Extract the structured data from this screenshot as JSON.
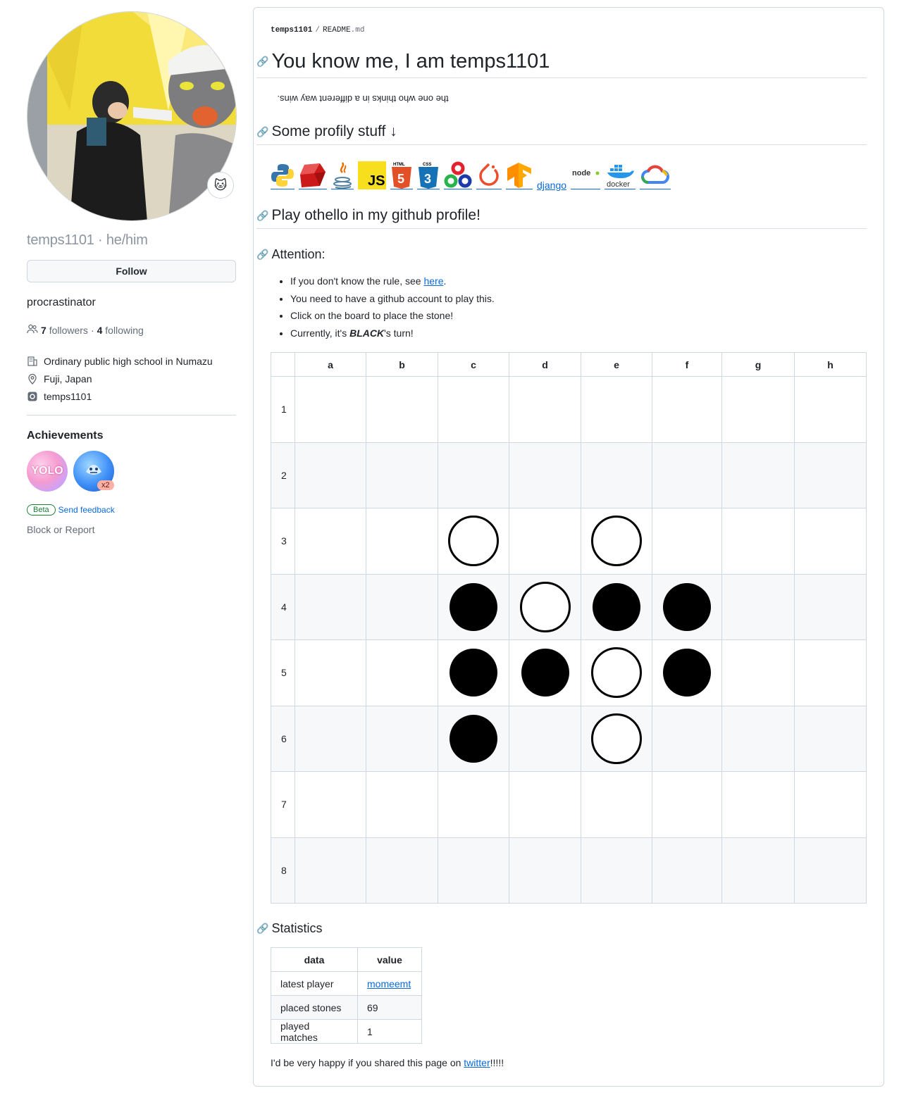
{
  "profile": {
    "username": "temps1101",
    "pronouns": "he/him",
    "follow_label": "Follow",
    "bio": "procrastinator",
    "followers_count": "7",
    "followers_label": "followers",
    "following_count": "4",
    "following_label": "following",
    "separator": "·",
    "organization": "Ordinary public high school in Numazu",
    "location": "Fuji, Japan",
    "instagram": "temps1101",
    "achievements_title": "Achievements",
    "achievements": [
      {
        "name": "yolo",
        "text": "YOLO"
      },
      {
        "name": "pull-shark",
        "multiplier": "x2"
      }
    ],
    "beta_label": "Beta",
    "feedback_label": "Send feedback",
    "block_label": "Block or Report"
  },
  "readme": {
    "crumb_user": "temps1101",
    "crumb_sep": "/",
    "crumb_file": "README",
    "crumb_ext": ".md",
    "title": "You know me, I am temps1101",
    "tagline": "the one who thinks in a different way wins.",
    "profily_heading": "Some profily stuff ↓",
    "tech_icons": [
      "python",
      "ruby",
      "java",
      "javascript",
      "html5",
      "css3",
      "opencv",
      "pytorch",
      "tensorflow",
      "django",
      "nodejs",
      "docker",
      "gcp"
    ],
    "django_alt": "django",
    "docker_label": "docker",
    "node_label": "node",
    "js_label": "JS",
    "othello_heading": "Play othello in my github profile!",
    "attention_heading": "Attention:",
    "rules_prefix": "If you don't know the rule, see ",
    "rules_link": "here",
    "rules_suffix": ".",
    "bullet2": "You need to have a github account to play this.",
    "bullet3": "Click on the board to place the stone!",
    "bullet4_prefix": "Currently, it's ",
    "bullet4_turn": "BLACK",
    "bullet4_suffix": "'s turn!",
    "columns": [
      "a",
      "b",
      "c",
      "d",
      "e",
      "f",
      "g",
      "h"
    ],
    "rows": [
      "1",
      "2",
      "3",
      "4",
      "5",
      "6",
      "7",
      "8"
    ],
    "board": [
      "........",
      "........",
      "..W.W...",
      "..BWBB..",
      "..BBWB..",
      "..B.W...",
      "........",
      "........"
    ],
    "stats_heading": "Statistics",
    "stats_headers": [
      "data",
      "value"
    ],
    "stats": [
      {
        "label": "latest player",
        "value": "momeemt"
      },
      {
        "label": "placed stones",
        "value": "69"
      },
      {
        "label": "played matches",
        "value": "1"
      }
    ],
    "share_prefix": "I'd be very happy if you shared this page on ",
    "share_link": "twitter",
    "share_suffix": "!!!!!"
  },
  "colors": {
    "link": "#0969da",
    "border": "#d0d7de",
    "muted": "#636c76",
    "stripe": "#f6f8fa",
    "beta": "#1a7f37"
  }
}
